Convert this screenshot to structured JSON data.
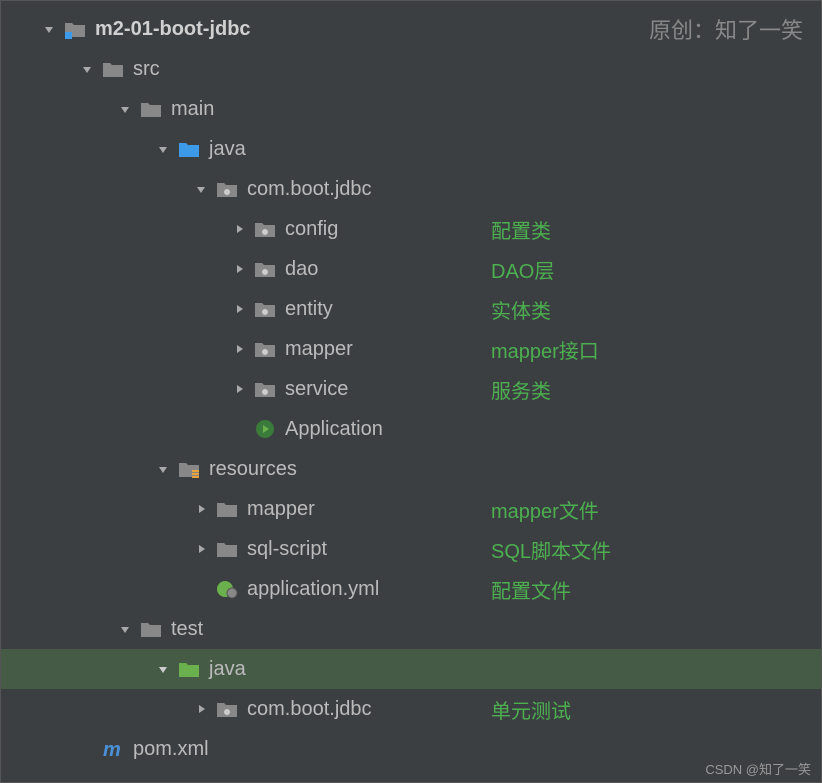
{
  "watermark": "原创：知了一笑",
  "footer": "CSDN @知了一笑",
  "tree": {
    "root": {
      "name": "m2-01-boot-jdbc",
      "children": {
        "src": {
          "name": "src",
          "main": {
            "name": "main",
            "java": {
              "name": "java",
              "pkg": {
                "name": "com.boot.jdbc",
                "config": {
                  "name": "config",
                  "annotation": "配置类"
                },
                "dao": {
                  "name": "dao",
                  "annotation": "DAO层"
                },
                "entity": {
                  "name": "entity",
                  "annotation": "实体类"
                },
                "mapper": {
                  "name": "mapper",
                  "annotation": "mapper接口"
                },
                "service": {
                  "name": "service",
                  "annotation": "服务类"
                },
                "application": {
                  "name": "Application"
                }
              }
            },
            "resources": {
              "name": "resources",
              "mapper": {
                "name": "mapper",
                "annotation": "mapper文件"
              },
              "sqlscript": {
                "name": "sql-script",
                "annotation": "SQL脚本文件"
              },
              "appyml": {
                "name": "application.yml",
                "annotation": "配置文件"
              }
            }
          },
          "test": {
            "name": "test",
            "java": {
              "name": "java",
              "pkg": {
                "name": "com.boot.jdbc",
                "annotation": "单元测试"
              }
            }
          }
        },
        "pom": {
          "name": "pom.xml"
        }
      }
    }
  }
}
